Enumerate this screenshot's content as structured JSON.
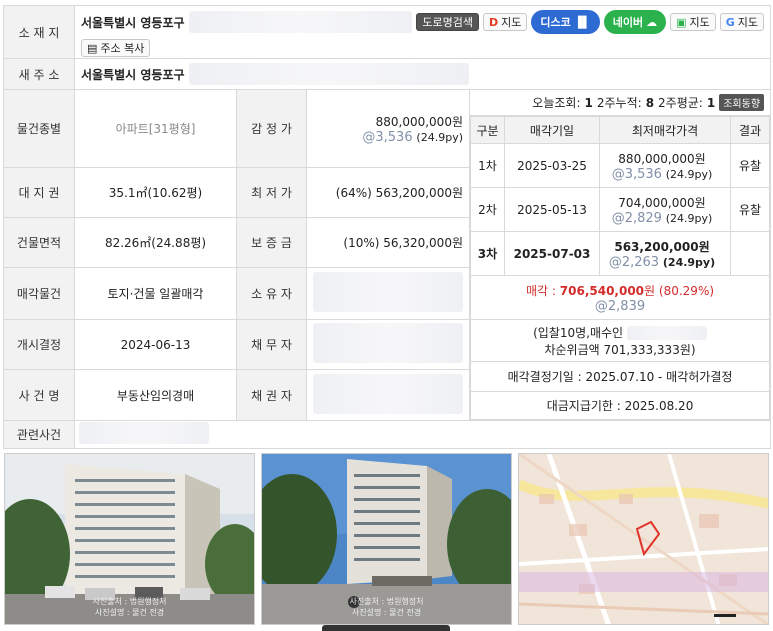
{
  "labels": {
    "location": "소 재 지",
    "new_address": "새 주 소",
    "type": "물건종별",
    "land_right": "대 지 권",
    "building_area": "건물면적",
    "sale_item": "매각물건",
    "start_decision": "개시결정",
    "case_name": "사 건 명",
    "related_case": "관련사건",
    "appraisal": "감 정 가",
    "min_price": "최 저 가",
    "deposit": "보 증 금",
    "owner": "소 유 자",
    "debtor": "채 무 자",
    "creditor": "채 권 자"
  },
  "location": {
    "address": "서울특별시 영등포구",
    "road_search": "도로명검색",
    "daum_map": "지도",
    "disco": "디스코",
    "naver": "네이버",
    "naver_map": "지도",
    "google_map": "지도",
    "copy": "주소 복사"
  },
  "new_address": {
    "address": "서울특별시 영등포구"
  },
  "values": {
    "type": "아파트",
    "type_size": "[31평형]",
    "land_right": "35.1㎡(10.62평)",
    "building_area": "82.26㎡(24.88평)",
    "sale_item": "토지·건물 일괄매각",
    "start_decision": "2024-06-13",
    "case_name": "부동산임의경매",
    "appraisal": "880,000,000원",
    "appraisal_unit": "@3,536",
    "appraisal_py": "(24.9py)",
    "min_price": "(64%) 563,200,000원",
    "deposit": "(10%) 56,320,000원"
  },
  "views": {
    "today_label": "오늘조회:",
    "today": "1",
    "two_week_label": "2주누적:",
    "two_week": "8",
    "avg_label": "2주평균:",
    "avg": "1",
    "stats_btn": "조회동향"
  },
  "history": {
    "headers": [
      "구분",
      "매각기일",
      "최저매각가격",
      "결과"
    ],
    "rows": [
      {
        "round": "1차",
        "date": "2025-03-25",
        "price": "880,000,000원",
        "unit": "@3,536",
        "py": "(24.9py)",
        "result": "유찰"
      },
      {
        "round": "2차",
        "date": "2025-05-13",
        "price": "704,000,000원",
        "unit": "@2,829",
        "py": "(24.9py)",
        "result": "유찰"
      },
      {
        "round": "3차",
        "date": "2025-07-03",
        "price": "563,200,000원",
        "unit": "@2,263",
        "py": "(24.9py)",
        "result": ""
      }
    ],
    "sale_label": "매각 :",
    "sale_price": "706,540,000",
    "sale_won": "원",
    "sale_rate": "(80.29%)",
    "sale_unit": "@2,839",
    "bid_line1": "(입찰10명,매수인",
    "bid_line2": "차순위금액 701,333,333원)",
    "decision": "매각결정기일 : 2025.07.10 - 매각허가결정",
    "payment": "대금지급기한 : 2025.08.20"
  },
  "photos": {
    "cap1a": "사진출처 : 법원행정처",
    "cap1b": "사진설명 : 물건 전경",
    "cap2a": "사진출처 : 법원행정처",
    "cap2b": "사진설명 : 물건 전경"
  }
}
